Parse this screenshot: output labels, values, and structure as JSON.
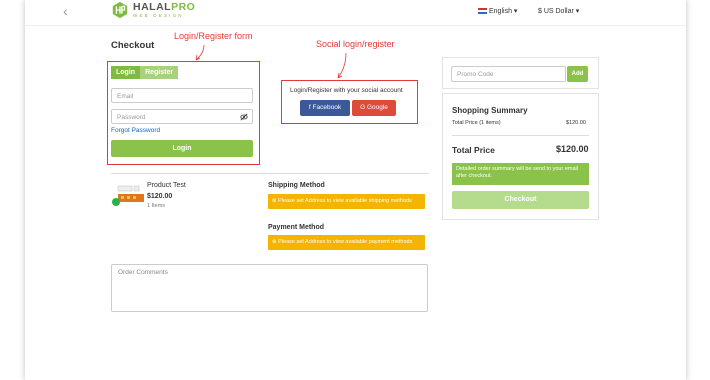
{
  "header": {
    "back_icon": "chevron-left-icon",
    "logo": {
      "brand": "HALAL",
      "brand_accent": "PRO",
      "tagline": "WEB DESIGN"
    },
    "language": "English ▾",
    "currency": "$ US Dollar ▾"
  },
  "page": {
    "title": "Checkout"
  },
  "annotations": {
    "login_register": "Login/Register form",
    "social": "Social login/register"
  },
  "login_form": {
    "tabs": [
      "Login",
      "Register"
    ],
    "email_placeholder": "Email",
    "password_placeholder": "Password",
    "forgot_link": "Forgot Password",
    "login_button": "Login"
  },
  "social": {
    "prompt": "Login/Register with your social account",
    "facebook_label": "f  Facebook",
    "google_label": "G  Google"
  },
  "product": {
    "name": "Product Test",
    "price": "$120.00",
    "quantity": "1 Items"
  },
  "shipping": {
    "label": "Shipping Method",
    "warning": "⊗ Please set Address to view available shipping methods"
  },
  "payment": {
    "label": "Payment Method",
    "warning": "⊗ Please set Address to view available payment methods"
  },
  "comments": {
    "placeholder": "Order Comments"
  },
  "summary": {
    "promo_placeholder": "Promo Code",
    "promo_button": "Add",
    "title": "Shopping Summary",
    "line_label": "Total Price (1 items)",
    "line_value": "$120.00",
    "total_label": "Total Price",
    "total_value": "$120.00",
    "notice": "Detailed order summary will be send to your email after checkout.",
    "checkout_button": "Checkout"
  },
  "colors": {
    "accent": "#8bc34a",
    "warning": "#f4b400",
    "facebook": "#3b5998",
    "google": "#dd4b39",
    "annotation": "#e53935"
  }
}
